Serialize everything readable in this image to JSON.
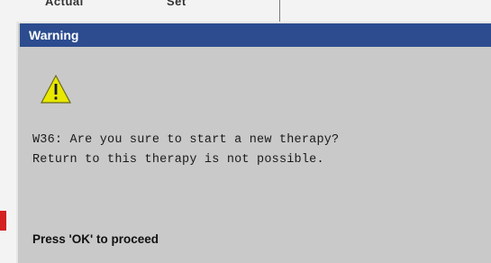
{
  "background": {
    "header_left": "Actual",
    "header_right": "Set"
  },
  "dialog": {
    "title": "Warning",
    "icon": "warning-triangle-icon",
    "message_line_1": "W36: Are you sure to start a new therapy?",
    "message_line_2": "Return to this therapy is not possible.",
    "footer": "Press 'OK' to proceed"
  },
  "colors": {
    "titlebar": "#2c4c8f",
    "dialog_bg": "#c9c9c9",
    "icon_fill": "#e8e800",
    "marker": "#d42020"
  }
}
